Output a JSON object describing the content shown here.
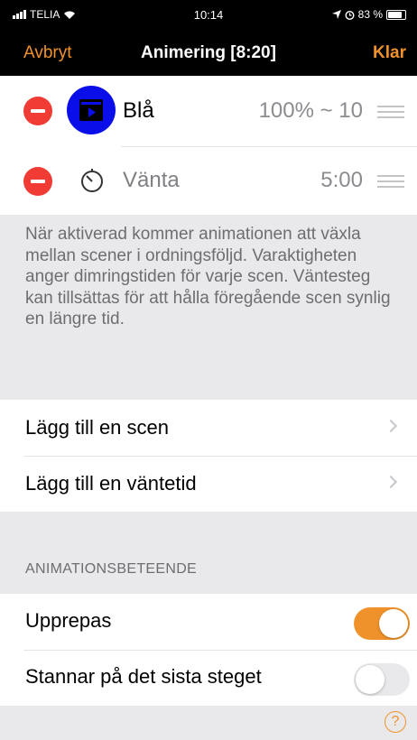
{
  "status_bar": {
    "carrier": "TELIA",
    "time": "10:14",
    "battery": "83 %",
    "battery_level": 0.83
  },
  "nav": {
    "cancel": "Avbryt",
    "title": "Animering [8:20]",
    "done": "Klar"
  },
  "steps": [
    {
      "name": "Blå",
      "value": "100% ~ 10",
      "icon": "scene-icon",
      "icon_color": "#0a0ee9"
    },
    {
      "name": "Vänta",
      "value": "5:00",
      "icon": "timer-icon"
    }
  ],
  "info_text": "När aktiverad kommer animationen att växla mellan scener i ordningsföljd. Varaktigheten anger dimringstiden för varje scen. Väntesteg kan tillsättas för att hålla föregående scen synlig en längre tid.",
  "add_actions": [
    {
      "label": "Lägg till en scen"
    },
    {
      "label": "Lägg till en väntetid"
    }
  ],
  "behavior": {
    "header": "ANIMATIONSBETEENDE",
    "items": [
      {
        "label": "Upprepas",
        "on": true
      },
      {
        "label": "Stannar på det sista steget",
        "on": false
      }
    ]
  },
  "help_icon": "?",
  "colors": {
    "accent": "#f0922b",
    "delete": "#f03c35",
    "scene_blue": "#0a0ee9"
  }
}
